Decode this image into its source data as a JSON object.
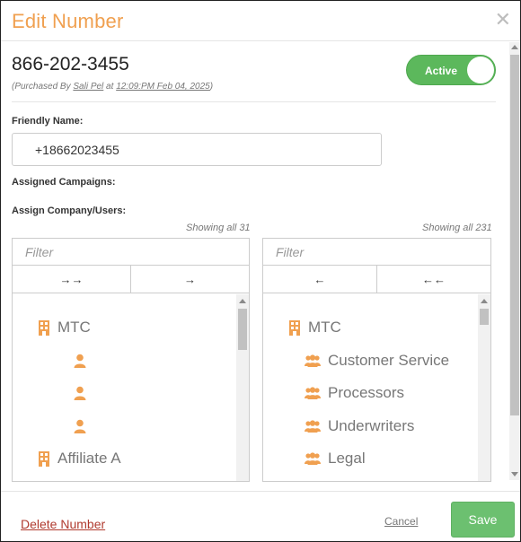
{
  "dialog": {
    "title": "Edit Number",
    "close_glyph": "✕"
  },
  "number": {
    "phone": "866-202-3455",
    "purchased_prefix": "(Purchased By ",
    "purchased_by": "Sali Pel",
    "purchased_mid": " at ",
    "purchased_at": "12:09:PM Feb 04, 2025",
    "purchased_suffix": ")",
    "status_label": "Active"
  },
  "form": {
    "friendly_name_label": "Friendly Name:",
    "friendly_name_value": "+18662023455",
    "assigned_campaigns_label": "Assigned Campaigns:",
    "assign_company_label": "Assign Company/Users:"
  },
  "left_panel": {
    "showing": "Showing all 31",
    "filter_placeholder": "Filter",
    "move_all_glyph": "→→",
    "move_one_glyph": "→",
    "items": [
      {
        "type": "company",
        "icon": "building-icon",
        "label": "MTC"
      },
      {
        "type": "user",
        "icon": "user-icon",
        "label": ""
      },
      {
        "type": "user",
        "icon": "user-icon",
        "label": ""
      },
      {
        "type": "user",
        "icon": "user-icon",
        "label": ""
      },
      {
        "type": "company",
        "icon": "building-icon",
        "label": "Affiliate A"
      }
    ]
  },
  "right_panel": {
    "showing": "Showing all 231",
    "filter_placeholder": "Filter",
    "move_one_glyph": "←",
    "move_all_glyph": "←←",
    "items": [
      {
        "type": "company",
        "icon": "building-icon",
        "label": "MTC"
      },
      {
        "type": "group",
        "icon": "users-icon",
        "label": "Customer Service"
      },
      {
        "type": "group",
        "icon": "users-icon",
        "label": "Processors"
      },
      {
        "type": "group",
        "icon": "users-icon",
        "label": "Underwriters"
      },
      {
        "type": "group",
        "icon": "users-icon",
        "label": "Legal"
      }
    ]
  },
  "footer": {
    "delete_label": "Delete Number",
    "cancel_label": "Cancel",
    "save_label": "Save"
  },
  "colors": {
    "title": "#f0a050",
    "icon": "#f0a050",
    "toggle_active": "#5cb85c",
    "save_button": "#6cc070",
    "delete_link": "#b03a2e"
  }
}
